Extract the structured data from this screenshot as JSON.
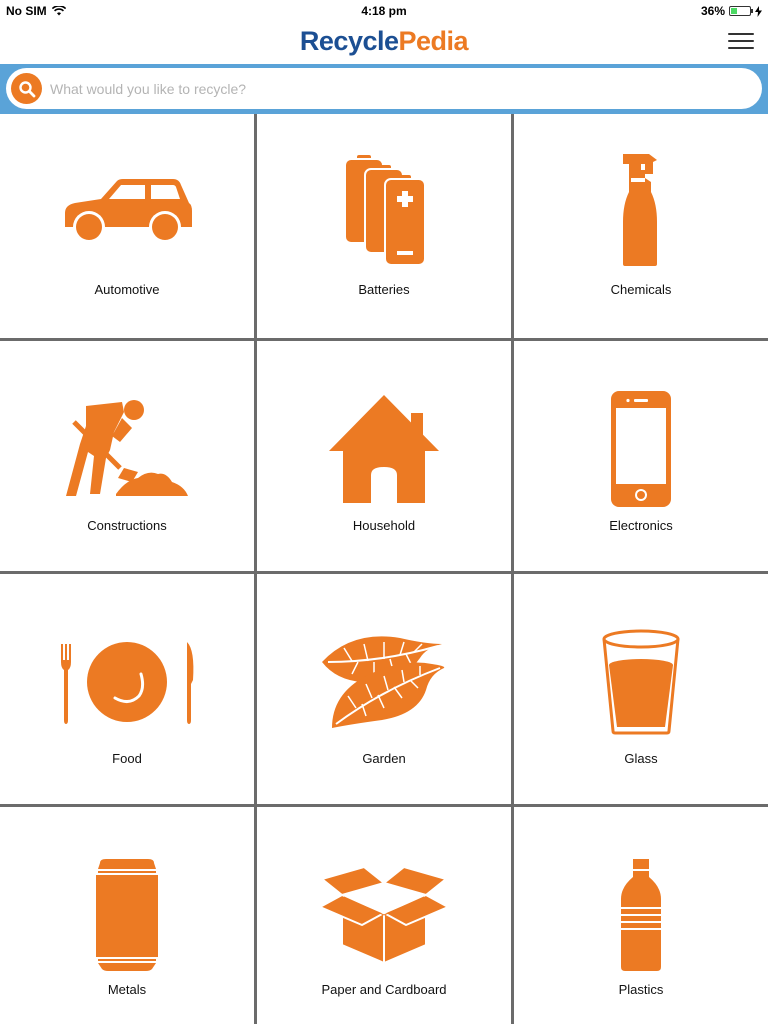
{
  "status_bar": {
    "carrier": "No SIM",
    "time": "4:18 pm",
    "battery": "36%",
    "battery_level": 0.36
  },
  "header": {
    "logo_part1": "Recycle",
    "logo_part2": "Pedia",
    "menu_icon": "hamburger-menu-icon"
  },
  "search": {
    "placeholder": "What would you like to recycle?",
    "value": "",
    "icon": "search-icon"
  },
  "colors": {
    "accent": "#ec7a23",
    "brand_blue": "#1c4f93",
    "search_bar": "#5aa3d8",
    "grid_lines": "#6b6b6b"
  },
  "categories": [
    {
      "label": "Automotive",
      "icon": "car-icon"
    },
    {
      "label": "Batteries",
      "icon": "batteries-icon"
    },
    {
      "label": "Chemicals",
      "icon": "spray-bottle-icon"
    },
    {
      "label": "Constructions",
      "icon": "worker-shovel-icon"
    },
    {
      "label": "Household",
      "icon": "house-icon"
    },
    {
      "label": "Electronics",
      "icon": "smartphone-icon"
    },
    {
      "label": "Food",
      "icon": "plate-cutlery-icon"
    },
    {
      "label": "Garden",
      "icon": "leaves-icon"
    },
    {
      "label": "Glass",
      "icon": "drinking-glass-icon"
    },
    {
      "label": "Metals",
      "icon": "can-icon"
    },
    {
      "label": "Paper and Cardboard",
      "icon": "cardboard-box-icon"
    },
    {
      "label": "Plastics",
      "icon": "plastic-bottle-icon"
    }
  ]
}
